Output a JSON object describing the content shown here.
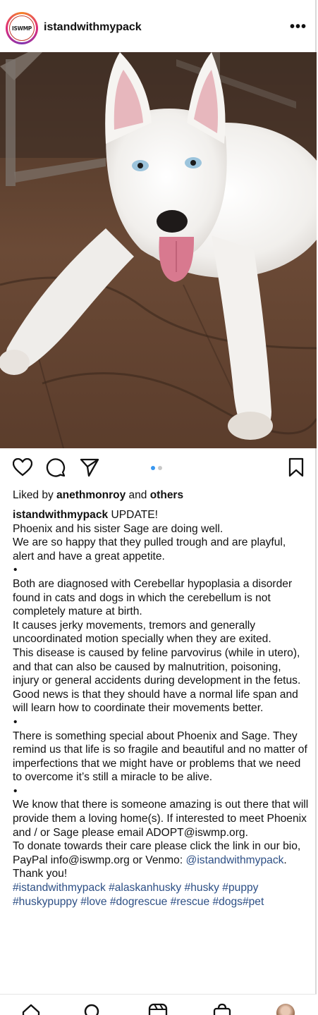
{
  "post": {
    "username": "istandwithmypack",
    "avatar_text": "ISWMP",
    "more_label": "•••"
  },
  "image": {
    "description": "dog-photo"
  },
  "actions": {
    "icons": [
      "heart-icon",
      "comment-icon",
      "share-icon",
      "bookmark-icon"
    ],
    "carousel_total": 2,
    "carousel_active": 1
  },
  "likes": {
    "prefix": "Liked by ",
    "user": "anethmonroy",
    "joiner": " and ",
    "others": "others"
  },
  "caption": {
    "username": "istandwithmypack",
    "first_line": " UPDATE!",
    "paragraphs": [
      "Phoenix and his sister Sage are doing well.",
      "We are so happy that they pulled trough and are playful, alert and have a great appetite.",
      "•",
      "Both are diagnosed with Cerebellar hypoplasia a disorder found in cats and dogs in which the cerebellum is not completely mature at birth.",
      "It causes jerky movements, tremors and generally uncoordinated motion specially when they are exited.",
      "This disease is caused by feline parvovirus (while in utero), and that can also be caused by malnutrition, poisoning, injury or general accidents during development in the fetus.",
      "Good news is that they should have a normal life span and will learn how to coordinate their movements better.",
      "•",
      "There is something special about Phoenix and Sage. They remind us that life is so fragile and beautiful and no matter of imperfections that we might have or problems that we need to overcome it’s still a miracle to be alive.",
      "•",
      "We know that there is someone amazing is out there that will provide them a loving home(s). If interested to meet Phoenix and / or Sage please email ADOPT@iswmp.org."
    ],
    "donate_text": "To donate towards their care please click the link in our bio, PayPal info@iswmp.org or Venmo: ",
    "venmo_link": "@istandwithmypack",
    "donate_end": ".",
    "thanks": "Thank you!",
    "hashtags": "#istandwithmypack #alaskanhusky #husky #puppy #huskypuppy #love #dogrescue #rescue #dogs#pet"
  },
  "bottom_nav": {
    "items": [
      "home-icon",
      "search-icon",
      "reels-icon",
      "shop-icon",
      "profile-avatar"
    ]
  },
  "colors": {
    "link": "#2d4f85",
    "carousel_active": "#3897f0",
    "carousel_inactive": "#c8c8c8"
  }
}
